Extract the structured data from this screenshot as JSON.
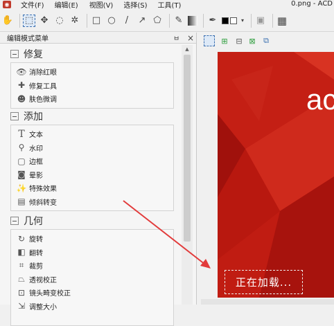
{
  "menubar": {
    "file": "文件(F)",
    "edit": "编辑(E)",
    "view": "视图(V)",
    "select": "选择(S)",
    "tools": "工具(T)",
    "title": "0.png - ACD"
  },
  "panel": {
    "title": "编辑模式菜单",
    "pin": "ㅂ",
    "close": "×"
  },
  "groups": {
    "repair": {
      "title": "修复",
      "items": [
        "消除红眼",
        "修复工具",
        "肤色微调"
      ]
    },
    "add": {
      "title": "添加",
      "items": [
        "文本",
        "水印",
        "边框",
        "晕影",
        "特殊效果",
        "倾斜转变"
      ]
    },
    "geometry": {
      "title": "几何",
      "items": [
        "旋转",
        "翻转",
        "裁剪",
        "透视校正",
        "镜头畸变校正",
        "调整大小"
      ]
    }
  },
  "canvas": {
    "brand_text": "ac",
    "loading_text": "正在加载..."
  },
  "colors": {
    "canvas_red": "#b5150f",
    "arrow": "#e23b3b",
    "select_blue": "#3a6fb0"
  }
}
